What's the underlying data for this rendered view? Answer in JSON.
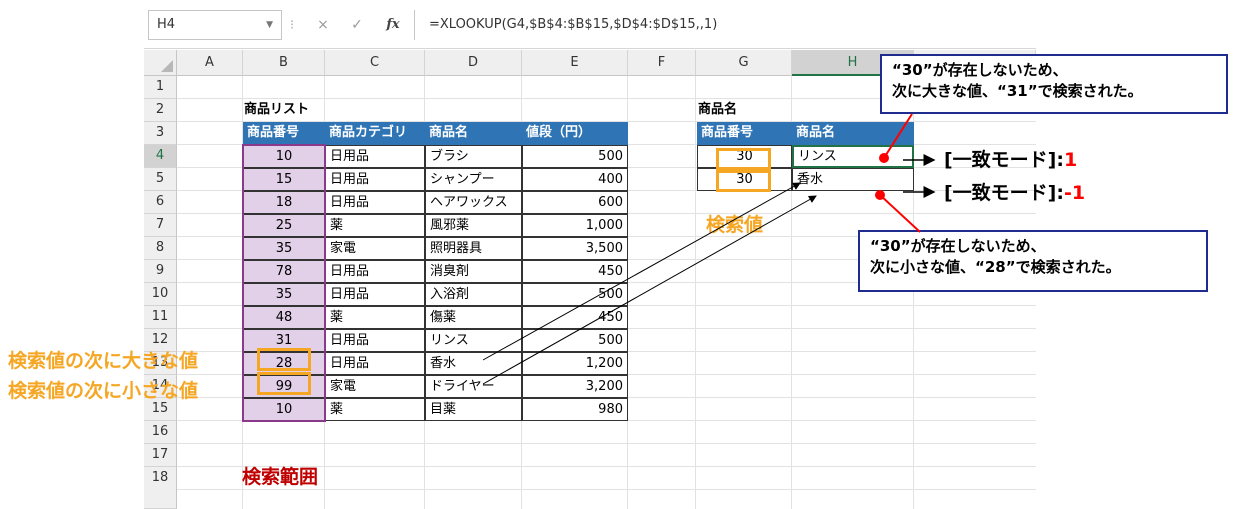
{
  "formula_bar": {
    "name_box": "H4",
    "cancel_icon": "×",
    "enter_icon": "✓",
    "fx_icon": "fx",
    "formula": "=XLOOKUP(G4,$B$4:$B$15,$D$4:$D$15,,1)"
  },
  "columns": [
    "A",
    "B",
    "C",
    "D",
    "E",
    "F",
    "G",
    "H"
  ],
  "rows": [
    "1",
    "2",
    "3",
    "4",
    "5",
    "6",
    "7",
    "8",
    "9",
    "10",
    "11",
    "12",
    "13",
    "14",
    "15",
    "16",
    "17",
    "18"
  ],
  "product_list": {
    "title": "商品リスト",
    "headers": [
      "商品番号",
      "商品カテゴリ",
      "商品名",
      "値段（円）"
    ],
    "rows": [
      [
        "10",
        "日用品",
        "ブラシ",
        "500"
      ],
      [
        "15",
        "日用品",
        "シャンプー",
        "400"
      ],
      [
        "18",
        "日用品",
        "ヘアワックス",
        "600"
      ],
      [
        "25",
        "薬",
        "風邪薬",
        "1,000"
      ],
      [
        "35",
        "家電",
        "照明器具",
        "3,500"
      ],
      [
        "78",
        "日用品",
        "消臭剤",
        "450"
      ],
      [
        "35",
        "日用品",
        "入浴剤",
        "500"
      ],
      [
        "48",
        "薬",
        "傷薬",
        "450"
      ],
      [
        "31",
        "日用品",
        "リンス",
        "500"
      ],
      [
        "28",
        "日用品",
        "香水",
        "1,200"
      ],
      [
        "99",
        "家電",
        "ドライヤー",
        "3,200"
      ],
      [
        "10",
        "薬",
        "目薬",
        "980"
      ]
    ]
  },
  "lookup_table": {
    "title": "商品名",
    "headers": [
      "商品番号",
      "商品名"
    ],
    "rows": [
      [
        "30",
        "リンス"
      ],
      [
        "30",
        "香水"
      ]
    ]
  },
  "annotations": {
    "search_value": "検索値",
    "search_range": "検索範囲",
    "next_larger": "検索値の次に大きな値",
    "next_smaller": "検索値の次に小さな値",
    "callout_top_line1": "“30”が存在しないため、",
    "callout_top_line2": "次に大きな値、“31”で検索された。",
    "callout_bottom_line1": "“30”が存在しないため、",
    "callout_bottom_line2": "次に小さな値、“28”で検索された。",
    "mode_label": "[一致モード]:",
    "mode1_value": "1",
    "mode2_value": "-1"
  },
  "colors": {
    "header_blue": "#2f75b5",
    "range_pink": "#e2cfe8",
    "orange": "#f5a623",
    "red": "#c00000",
    "callout_border": "#1f2c8f"
  }
}
